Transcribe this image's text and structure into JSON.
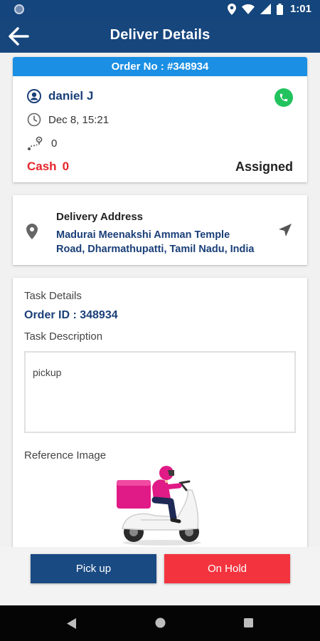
{
  "status_bar": {
    "time": "1:01",
    "icons": [
      "app-dot-icon",
      "location-icon",
      "wifi-icon",
      "signal-icon",
      "battery-icon"
    ]
  },
  "app_bar": {
    "title": "Deliver Details",
    "back_icon": "arrow-left-icon"
  },
  "order": {
    "header": "Order No : #348934",
    "customer_name": "daniel J",
    "date": "Dec 8, 15:21",
    "distance": "0",
    "cash_label": "Cash",
    "cash_value": "0",
    "status": "Assigned",
    "call_icon": "phone-icon"
  },
  "address": {
    "title": "Delivery Address",
    "line1": "Madurai Meenakshi Amman Temple",
    "line2": "Road, Dharmathupatti, Tamil Nadu, India"
  },
  "task": {
    "details_label": "Task Details",
    "order_id": "Order ID : 348934",
    "description_label": "Task Description",
    "description": "pickup",
    "reference_label": "Reference Image"
  },
  "actions": {
    "pickup": "Pick up",
    "hold": "On Hold"
  },
  "colors": {
    "primary": "#17467d",
    "header_blue": "#1a8fe3",
    "cash_red": "#e5252b",
    "hold_red": "#f3343f",
    "call_green": "#22c35e"
  }
}
